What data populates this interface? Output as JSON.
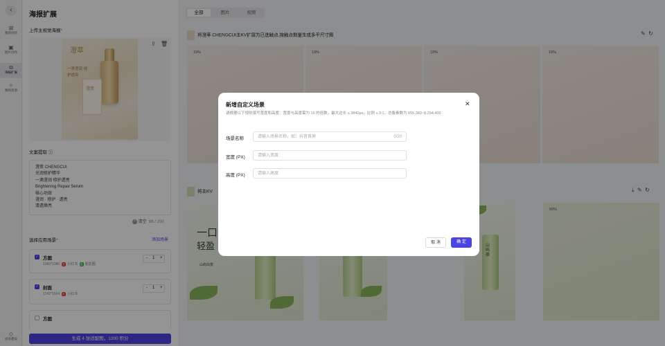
{
  "rail": {
    "back_icon": "chevron-left-icon",
    "items": [
      {
        "label": "我的创作",
        "icon": "grid-icon"
      },
      {
        "label": "图片创作",
        "icon": "image-icon"
      },
      {
        "label": "海报扩展",
        "icon": "expand-icon"
      },
      {
        "label": "我的资源",
        "icon": "star-icon"
      }
    ],
    "bottom_label": "投诉建议"
  },
  "left": {
    "title": "海报扩展",
    "upload_label": "上传主视觉海报",
    "required_mark": "*",
    "poster": {
      "brand": "澄萃",
      "slogan": "一滴澄润 修护透亮",
      "box_text": "澄萃"
    },
    "copy_label": "文案提取",
    "copy_lines": [
      "澄萃 CHENGCUI",
      "光润修护精华",
      "一滴澄润 修护透亮",
      "Brightening Repair Serum",
      "核心功效",
      "澄润 · 修护 · 透亮",
      "清透焕亮"
    ],
    "clear_label": "清空",
    "char_count": "86 / 200",
    "scene_label": "选择应用场景",
    "add_scene": "添加场景",
    "cards": [
      {
        "name": "方图",
        "size": "1080*1080",
        "platforms": [
          "小红书",
          "朋友圈"
        ],
        "qty": "1",
        "checked": true
      },
      {
        "name": "封面",
        "size": "1242*1664",
        "platforms": [
          "小红书"
        ],
        "qty": "1",
        "checked": true
      },
      {
        "name": "方图",
        "size": "",
        "platforms": [],
        "qty": "",
        "checked": false
      }
    ],
    "generate_label": "生成 4 张适配图，1200 积分"
  },
  "main": {
    "tabs": [
      "全部",
      "图片",
      "视频"
    ],
    "row1_title": "将澄萃 CHENGCUI主KV扩展为已选触点,按触点数量生成多平尺寸图",
    "row1_pcts": [
      "19%",
      "19%",
      "19%",
      "19%"
    ],
    "row2_title": "将主KV",
    "row2_pct": "99%",
    "tea_text": "一口清",
    "tea_text2": "轻盈",
    "tea_sub": "山屿白茶",
    "tea_brand": "山屿茶"
  },
  "modal": {
    "title": "新增自定义场景",
    "desc": "请根据以下规则填写宽度和高度：宽度与高度需为 16 的倍数，最大边长 ≤ 3840px，比例 ≤ 3:1，总像素数为 655,360~8,294,400",
    "fields": [
      {
        "label": "场景名称",
        "placeholder": "请输入场景名称，如：抖音首屏",
        "count": "0/20"
      },
      {
        "label": "宽度 (PX)",
        "placeholder": "请输入宽度"
      },
      {
        "label": "高度 (PX)",
        "placeholder": "请输入高度"
      }
    ],
    "cancel": "取 消",
    "confirm": "确 定"
  },
  "colors": {
    "accent": "#4b44e0",
    "required": "#e0463c"
  }
}
